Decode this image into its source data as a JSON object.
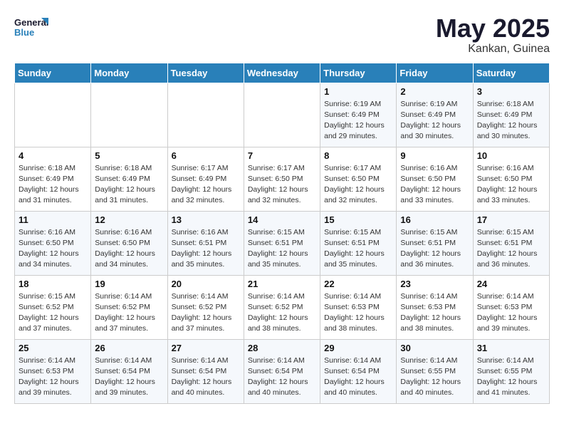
{
  "header": {
    "logo_line1": "General",
    "logo_line2": "Blue",
    "month": "May 2025",
    "location": "Kankan, Guinea"
  },
  "weekdays": [
    "Sunday",
    "Monday",
    "Tuesday",
    "Wednesday",
    "Thursday",
    "Friday",
    "Saturday"
  ],
  "weeks": [
    [
      {
        "day": "",
        "info": ""
      },
      {
        "day": "",
        "info": ""
      },
      {
        "day": "",
        "info": ""
      },
      {
        "day": "",
        "info": ""
      },
      {
        "day": "1",
        "info": "Sunrise: 6:19 AM\nSunset: 6:49 PM\nDaylight: 12 hours\nand 29 minutes."
      },
      {
        "day": "2",
        "info": "Sunrise: 6:19 AM\nSunset: 6:49 PM\nDaylight: 12 hours\nand 30 minutes."
      },
      {
        "day": "3",
        "info": "Sunrise: 6:18 AM\nSunset: 6:49 PM\nDaylight: 12 hours\nand 30 minutes."
      }
    ],
    [
      {
        "day": "4",
        "info": "Sunrise: 6:18 AM\nSunset: 6:49 PM\nDaylight: 12 hours\nand 31 minutes."
      },
      {
        "day": "5",
        "info": "Sunrise: 6:18 AM\nSunset: 6:49 PM\nDaylight: 12 hours\nand 31 minutes."
      },
      {
        "day": "6",
        "info": "Sunrise: 6:17 AM\nSunset: 6:49 PM\nDaylight: 12 hours\nand 32 minutes."
      },
      {
        "day": "7",
        "info": "Sunrise: 6:17 AM\nSunset: 6:50 PM\nDaylight: 12 hours\nand 32 minutes."
      },
      {
        "day": "8",
        "info": "Sunrise: 6:17 AM\nSunset: 6:50 PM\nDaylight: 12 hours\nand 32 minutes."
      },
      {
        "day": "9",
        "info": "Sunrise: 6:16 AM\nSunset: 6:50 PM\nDaylight: 12 hours\nand 33 minutes."
      },
      {
        "day": "10",
        "info": "Sunrise: 6:16 AM\nSunset: 6:50 PM\nDaylight: 12 hours\nand 33 minutes."
      }
    ],
    [
      {
        "day": "11",
        "info": "Sunrise: 6:16 AM\nSunset: 6:50 PM\nDaylight: 12 hours\nand 34 minutes."
      },
      {
        "day": "12",
        "info": "Sunrise: 6:16 AM\nSunset: 6:50 PM\nDaylight: 12 hours\nand 34 minutes."
      },
      {
        "day": "13",
        "info": "Sunrise: 6:16 AM\nSunset: 6:51 PM\nDaylight: 12 hours\nand 35 minutes."
      },
      {
        "day": "14",
        "info": "Sunrise: 6:15 AM\nSunset: 6:51 PM\nDaylight: 12 hours\nand 35 minutes."
      },
      {
        "day": "15",
        "info": "Sunrise: 6:15 AM\nSunset: 6:51 PM\nDaylight: 12 hours\nand 35 minutes."
      },
      {
        "day": "16",
        "info": "Sunrise: 6:15 AM\nSunset: 6:51 PM\nDaylight: 12 hours\nand 36 minutes."
      },
      {
        "day": "17",
        "info": "Sunrise: 6:15 AM\nSunset: 6:51 PM\nDaylight: 12 hours\nand 36 minutes."
      }
    ],
    [
      {
        "day": "18",
        "info": "Sunrise: 6:15 AM\nSunset: 6:52 PM\nDaylight: 12 hours\nand 37 minutes."
      },
      {
        "day": "19",
        "info": "Sunrise: 6:14 AM\nSunset: 6:52 PM\nDaylight: 12 hours\nand 37 minutes."
      },
      {
        "day": "20",
        "info": "Sunrise: 6:14 AM\nSunset: 6:52 PM\nDaylight: 12 hours\nand 37 minutes."
      },
      {
        "day": "21",
        "info": "Sunrise: 6:14 AM\nSunset: 6:52 PM\nDaylight: 12 hours\nand 38 minutes."
      },
      {
        "day": "22",
        "info": "Sunrise: 6:14 AM\nSunset: 6:53 PM\nDaylight: 12 hours\nand 38 minutes."
      },
      {
        "day": "23",
        "info": "Sunrise: 6:14 AM\nSunset: 6:53 PM\nDaylight: 12 hours\nand 38 minutes."
      },
      {
        "day": "24",
        "info": "Sunrise: 6:14 AM\nSunset: 6:53 PM\nDaylight: 12 hours\nand 39 minutes."
      }
    ],
    [
      {
        "day": "25",
        "info": "Sunrise: 6:14 AM\nSunset: 6:53 PM\nDaylight: 12 hours\nand 39 minutes."
      },
      {
        "day": "26",
        "info": "Sunrise: 6:14 AM\nSunset: 6:54 PM\nDaylight: 12 hours\nand 39 minutes."
      },
      {
        "day": "27",
        "info": "Sunrise: 6:14 AM\nSunset: 6:54 PM\nDaylight: 12 hours\nand 40 minutes."
      },
      {
        "day": "28",
        "info": "Sunrise: 6:14 AM\nSunset: 6:54 PM\nDaylight: 12 hours\nand 40 minutes."
      },
      {
        "day": "29",
        "info": "Sunrise: 6:14 AM\nSunset: 6:54 PM\nDaylight: 12 hours\nand 40 minutes."
      },
      {
        "day": "30",
        "info": "Sunrise: 6:14 AM\nSunset: 6:55 PM\nDaylight: 12 hours\nand 40 minutes."
      },
      {
        "day": "31",
        "info": "Sunrise: 6:14 AM\nSunset: 6:55 PM\nDaylight: 12 hours\nand 41 minutes."
      }
    ]
  ]
}
